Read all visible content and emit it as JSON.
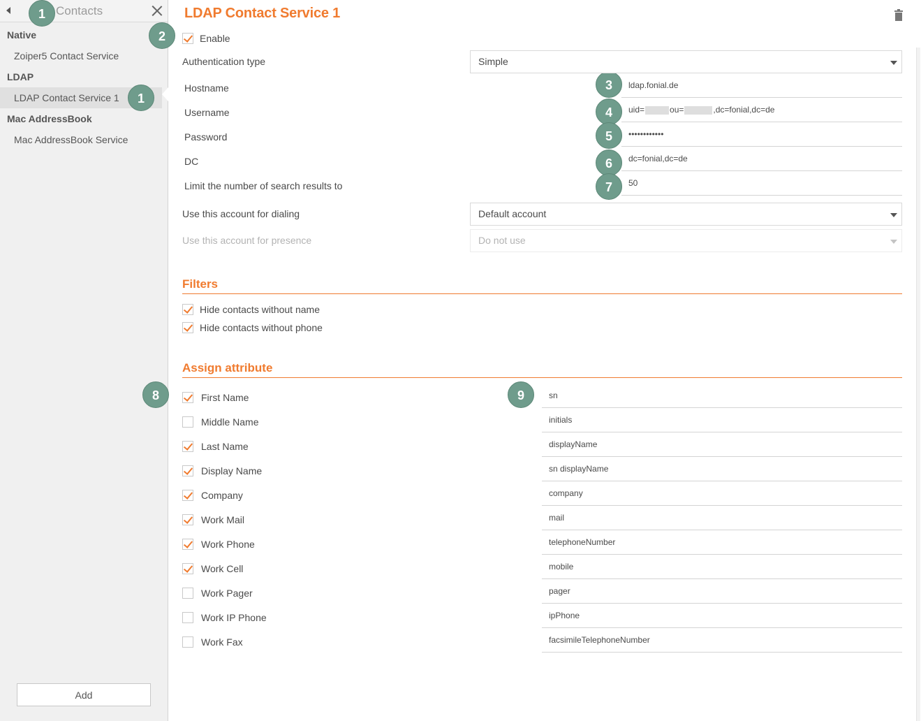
{
  "colors": {
    "accent": "#f07b2f",
    "badge": "#6f9c8c"
  },
  "sidebar": {
    "title": "Contacts",
    "groups": [
      {
        "label": "Native",
        "items": [
          "Zoiper5 Contact Service"
        ]
      },
      {
        "label": "LDAP",
        "items": [
          "LDAP Contact Service 1"
        ]
      },
      {
        "label": "Mac AddressBook",
        "items": [
          "Mac AddressBook Service"
        ]
      }
    ],
    "selected_item": "LDAP Contact Service 1",
    "add_label": "Add"
  },
  "badges": [
    "1",
    "1",
    "2",
    "3",
    "4",
    "5",
    "6",
    "7",
    "8",
    "9"
  ],
  "main": {
    "title": "LDAP Contact Service 1",
    "enable_label": "Enable",
    "enable_checked": true,
    "auth_type": {
      "label": "Authentication type",
      "value": "Simple"
    },
    "hostname": {
      "label": "Hostname",
      "value": "ldap.fonial.de"
    },
    "username": {
      "label": "Username",
      "prefix": "uid=",
      "mid": "ou=",
      "suffix": ",dc=fonial,dc=de"
    },
    "password": {
      "label": "Password",
      "value": "••••••••••••"
    },
    "dc": {
      "label": "DC",
      "value": "dc=fonial,dc=de"
    },
    "limit": {
      "label": "Limit the number of search results to",
      "value": "50"
    },
    "dialing": {
      "label": "Use this account for dialing",
      "value": "Default account"
    },
    "presence": {
      "label": "Use this account for presence",
      "value": "Do not use"
    }
  },
  "filters": {
    "title": "Filters",
    "items": [
      {
        "label": "Hide contacts without name",
        "checked": true
      },
      {
        "label": "Hide contacts without phone",
        "checked": true
      }
    ]
  },
  "assign": {
    "title": "Assign attribute",
    "rows": [
      {
        "label": "First Name",
        "checked": true,
        "value": "sn"
      },
      {
        "label": "Middle Name",
        "checked": false,
        "value": "initials"
      },
      {
        "label": "Last Name",
        "checked": true,
        "value": "displayName"
      },
      {
        "label": "Display Name",
        "checked": true,
        "value": "sn displayName"
      },
      {
        "label": "Company",
        "checked": true,
        "value": "company"
      },
      {
        "label": "Work Mail",
        "checked": true,
        "value": "mail"
      },
      {
        "label": "Work Phone",
        "checked": true,
        "value": "telephoneNumber"
      },
      {
        "label": "Work Cell",
        "checked": true,
        "value": "mobile"
      },
      {
        "label": "Work Pager",
        "checked": false,
        "value": "pager"
      },
      {
        "label": "Work IP Phone",
        "checked": false,
        "value": "ipPhone"
      },
      {
        "label": "Work Fax",
        "checked": false,
        "value": "facsimileTelephoneNumber"
      }
    ]
  }
}
